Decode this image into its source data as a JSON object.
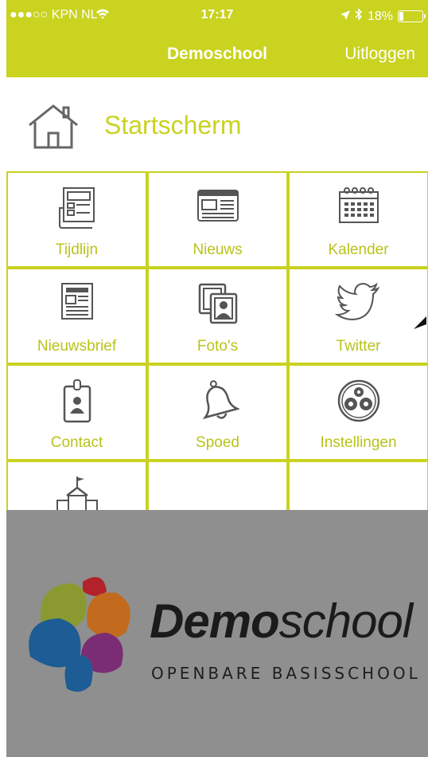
{
  "status": {
    "carrier": "●●●○○ KPN NL",
    "time": "17:17",
    "battery": "18%",
    "battery_level": 0.18
  },
  "navbar": {
    "title": "Demoschool",
    "logout": "Uitloggen"
  },
  "header": {
    "title": "Startscherm",
    "icon": "home-icon"
  },
  "tiles": [
    {
      "label": "Tijdlijn",
      "icon": "timeline-icon"
    },
    {
      "label": "Nieuws",
      "icon": "news-icon"
    },
    {
      "label": "Kalender",
      "icon": "calendar-icon"
    },
    {
      "label": "Nieuwsbrief",
      "icon": "newsletter-icon"
    },
    {
      "label": "Foto's",
      "icon": "photos-icon"
    },
    {
      "label": "Twitter",
      "icon": "twitter-icon"
    },
    {
      "label": "Contact",
      "icon": "contact-icon"
    },
    {
      "label": "Spoed",
      "icon": "bell-icon"
    },
    {
      "label": "Instellingen",
      "icon": "settings-icon"
    },
    {
      "label": "",
      "icon": "school-icon"
    }
  ],
  "splash": {
    "brand_bold": "Demo",
    "brand_light": "school",
    "subtitle": "OPENBARE BASISSCHOOL"
  },
  "colors": {
    "accent": "#c9d320",
    "overlay": "#8f8f8f"
  }
}
